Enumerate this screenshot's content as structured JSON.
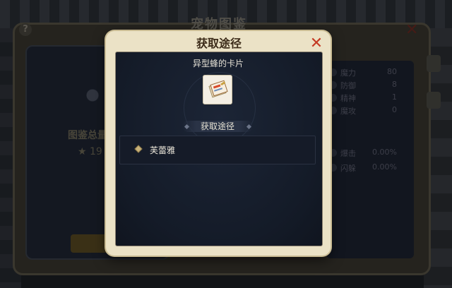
{
  "background": {
    "title": "宠物图鉴",
    "card_label": "图鉴总量",
    "card_count": "19",
    "stats": [
      {
        "name": "魔力",
        "value": "80"
      },
      {
        "name": "防御",
        "value": "8"
      },
      {
        "name": "精神",
        "value": "1"
      },
      {
        "name": "魔攻",
        "value": "0"
      },
      {
        "name": "爆击",
        "value": "0.00%"
      },
      {
        "name": "闪躲",
        "value": "0.00%"
      }
    ]
  },
  "dialog": {
    "title": "获取途径",
    "close_icon": "close-x-icon",
    "item_name": "异型蜂的卡片",
    "item_icon": "card-icon",
    "section_label": "获取途径",
    "sources": [
      {
        "label": "芙蕾雅",
        "icon": "diamond-bullet-icon"
      }
    ]
  },
  "colors": {
    "title_text": "#3b2a18",
    "close": "#c43a23",
    "panel_bg": "#141b28",
    "frame": "#ebe2c6"
  }
}
